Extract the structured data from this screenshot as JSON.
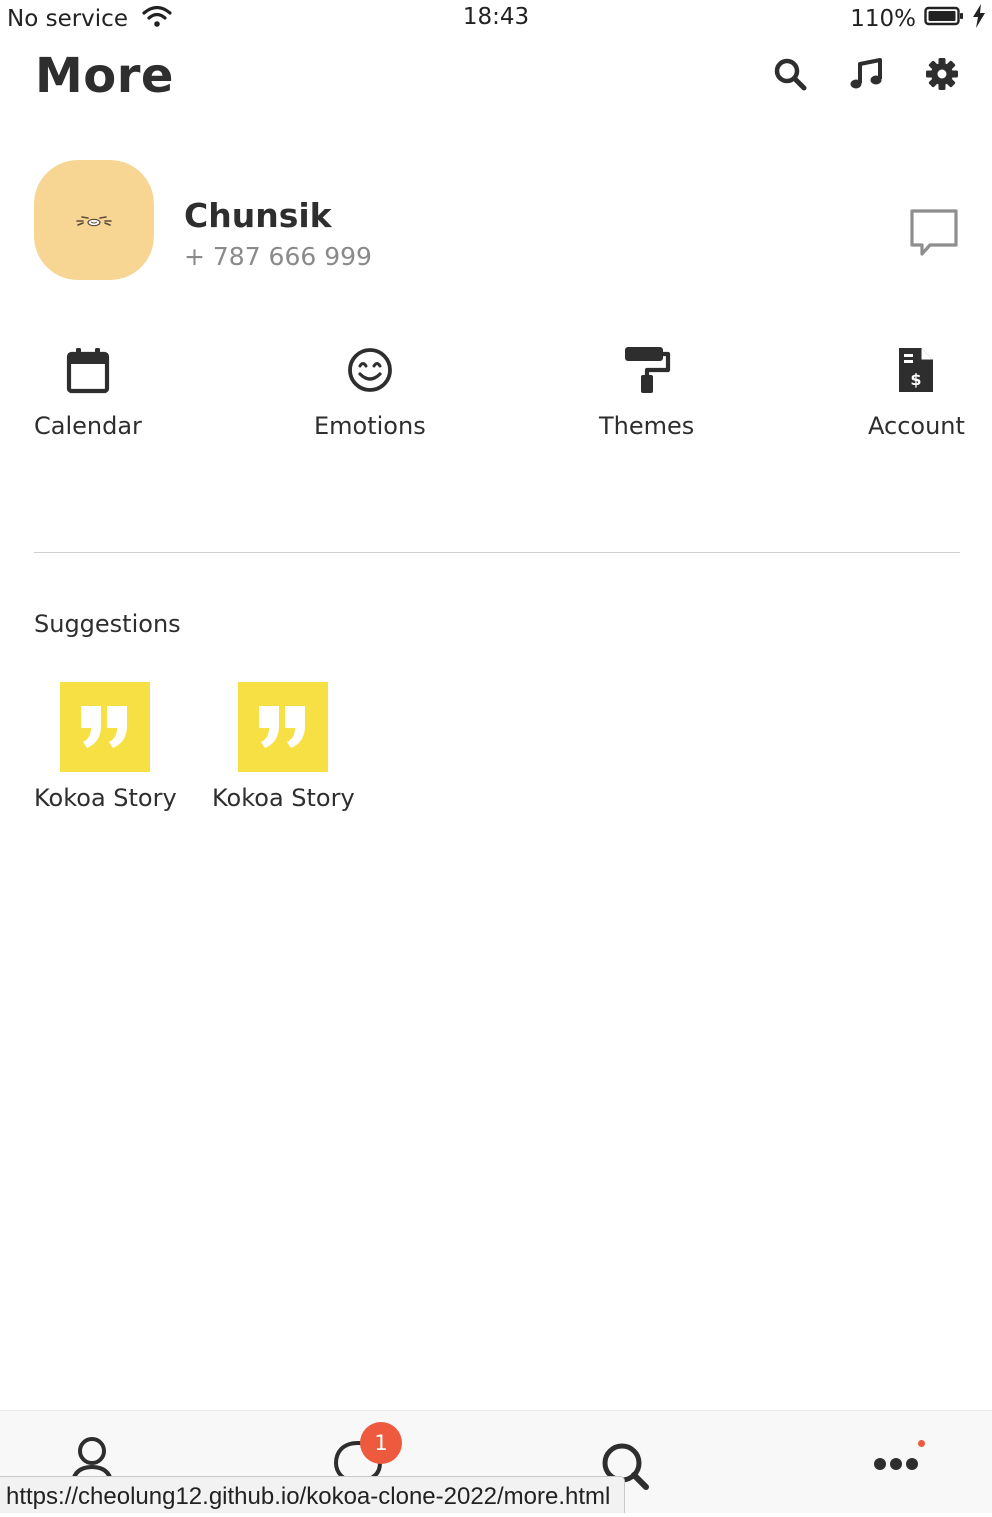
{
  "status_bar": {
    "carrier": "No service",
    "time": "18:43",
    "battery": "110%"
  },
  "header": {
    "title": "More",
    "icons": [
      "search-icon",
      "music-icon",
      "gear-icon"
    ]
  },
  "profile": {
    "name": "Chunsik",
    "phone": "+ 787 666 999",
    "avatar_color": "#f7d694"
  },
  "actions": [
    {
      "label": "Calendar",
      "icon": "calendar-icon"
    },
    {
      "label": "Emotions",
      "icon": "smile-icon"
    },
    {
      "label": "Themes",
      "icon": "paint-roller-icon"
    },
    {
      "label": "Account",
      "icon": "invoice-dollar-icon"
    }
  ],
  "suggestions": {
    "title": "Suggestions",
    "items": [
      {
        "label": "Kokoa Story",
        "icon": "quote-icon"
      },
      {
        "label": "Kokoa Story",
        "icon": "quote-icon"
      }
    ],
    "tile_color": "#f6e043"
  },
  "tab_bar": {
    "tabs": [
      "user-icon",
      "chat-icon",
      "search-icon",
      "more-dots-icon"
    ],
    "chat_badge": "1",
    "badge_color": "#ee5a3e"
  },
  "url_status": "https://cheolung12.github.io/kokoa-clone-2022/more.html"
}
